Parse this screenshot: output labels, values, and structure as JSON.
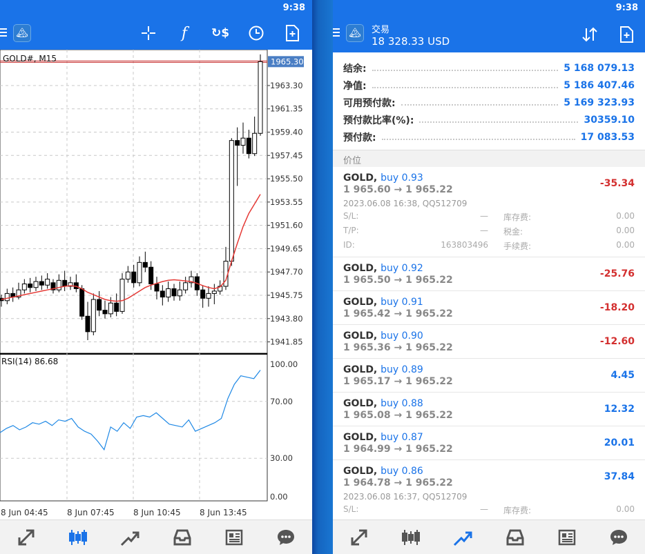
{
  "left": {
    "time": "9:38",
    "chart_title": "GOLD#, M15",
    "current_price": "1965.30",
    "price_ticks": [
      "1963.30",
      "1961.35",
      "1959.40",
      "1957.45",
      "1955.50",
      "1953.55",
      "1951.60",
      "1949.65",
      "1947.70",
      "1945.75",
      "1943.80",
      "1941.85"
    ],
    "rsi_label": "RSI(14) 86.68",
    "rsi_ticks": [
      "100.00",
      "70.00",
      "30.00",
      "0.00"
    ],
    "time_ticks": [
      "8 Jun 04:45",
      "8 Jun 07:45",
      "8 Jun 10:45",
      "8 Jun 13:45"
    ]
  },
  "right": {
    "time": "9:38",
    "title": "交易",
    "balance_header": "18 328.33 USD",
    "summary": [
      {
        "label": "结余:",
        "value": "5 168 079.13"
      },
      {
        "label": "净值:",
        "value": "5 186 407.46"
      },
      {
        "label": "可用预付款:",
        "value": "5 169 323.93"
      },
      {
        "label": "预付款比率(%):",
        "value": "30359.10"
      },
      {
        "label": "预付款:",
        "value": "17 083.53"
      }
    ],
    "section_label": "价位",
    "orders": [
      {
        "symbol": "GOLD,",
        "side": "buy 0.93",
        "prices": "1 965.60 → 1 965.22",
        "pl": "-35.34",
        "sign": "neg",
        "meta": "2023.06.08 16:38, QQ512709",
        "details": [
          [
            "S/L:",
            "—",
            "库存费:",
            "0.00"
          ],
          [
            "T/P:",
            "—",
            "税金:",
            "0.00"
          ],
          [
            "ID:",
            "163803496",
            "手续费:",
            "0.00"
          ]
        ]
      },
      {
        "symbol": "GOLD,",
        "side": "buy 0.92",
        "prices": "1 965.50 → 1 965.22",
        "pl": "-25.76",
        "sign": "neg"
      },
      {
        "symbol": "GOLD,",
        "side": "buy 0.91",
        "prices": "1 965.42 → 1 965.22",
        "pl": "-18.20",
        "sign": "neg"
      },
      {
        "symbol": "GOLD,",
        "side": "buy 0.90",
        "prices": "1 965.36 → 1 965.22",
        "pl": "-12.60",
        "sign": "neg"
      },
      {
        "symbol": "GOLD,",
        "side": "buy 0.89",
        "prices": "1 965.17 → 1 965.22",
        "pl": "4.45",
        "sign": "pos"
      },
      {
        "symbol": "GOLD,",
        "side": "buy 0.88",
        "prices": "1 965.08 → 1 965.22",
        "pl": "12.32",
        "sign": "pos"
      },
      {
        "symbol": "GOLD,",
        "side": "buy 0.87",
        "prices": "1 964.99 → 1 965.22",
        "pl": "20.01",
        "sign": "pos"
      },
      {
        "symbol": "GOLD,",
        "side": "buy 0.86",
        "prices": "1 964.78 → 1 965.22",
        "pl": "37.84",
        "sign": "pos",
        "meta": "2023.06.08 16:37, QQ512709",
        "details": [
          [
            "S/L:",
            "—",
            "库存费:",
            "0.00"
          ]
        ]
      }
    ]
  },
  "colors": {
    "accent": "#1a73e8",
    "negative": "#d32f2f",
    "candle_up": "#ffffff",
    "candle_down": "#000000",
    "ma_line": "#e53935",
    "rsi_line": "#1e88e5"
  },
  "chart_data": [
    {
      "type": "candlestick",
      "title": "GOLD#, M15",
      "ylim": [
        1940.9,
        1966.3
      ],
      "candles": [
        [
          1945.5,
          1945.3,
          1945.8,
          1944.8
        ],
        [
          1945.3,
          1945.9,
          1946.3,
          1945.0
        ],
        [
          1945.9,
          1945.6,
          1946.4,
          1945.2
        ],
        [
          1945.6,
          1946.2,
          1946.8,
          1945.4
        ],
        [
          1946.2,
          1946.7,
          1947.1,
          1945.9
        ],
        [
          1946.7,
          1946.4,
          1947.2,
          1946.0
        ],
        [
          1946.4,
          1946.9,
          1947.3,
          1946.1
        ],
        [
          1946.9,
          1946.6,
          1947.4,
          1946.2
        ],
        [
          1946.6,
          1947.1,
          1947.6,
          1946.3
        ],
        [
          1946.8,
          1946.2,
          1947.1,
          1945.9
        ],
        [
          1946.2,
          1947.0,
          1947.5,
          1946.0
        ],
        [
          1947.0,
          1946.5,
          1947.8,
          1946.1
        ],
        [
          1946.5,
          1946.8,
          1947.3,
          1946.2
        ],
        [
          1946.8,
          1946.3,
          1947.5,
          1946.0
        ],
        [
          1946.3,
          1944.0,
          1946.6,
          1943.7
        ],
        [
          1944.0,
          1942.7,
          1945.2,
          1942.0
        ],
        [
          1942.7,
          1945.4,
          1945.9,
          1942.4
        ],
        [
          1945.4,
          1944.5,
          1946.1,
          1944.0
        ],
        [
          1944.5,
          1944.2,
          1945.3,
          1943.8
        ],
        [
          1944.2,
          1945.1,
          1945.6,
          1943.9
        ],
        [
          1945.1,
          1944.4,
          1945.9,
          1944.0
        ],
        [
          1944.4,
          1947.1,
          1947.6,
          1944.2
        ],
        [
          1947.1,
          1947.7,
          1948.2,
          1946.8
        ],
        [
          1947.7,
          1946.8,
          1948.3,
          1946.4
        ],
        [
          1946.8,
          1948.5,
          1949.0,
          1946.5
        ],
        [
          1948.5,
          1948.1,
          1949.4,
          1947.7
        ],
        [
          1948.1,
          1946.7,
          1948.6,
          1946.2
        ],
        [
          1946.7,
          1946.1,
          1947.3,
          1945.4
        ],
        [
          1946.1,
          1945.6,
          1946.6,
          1944.9
        ],
        [
          1945.6,
          1946.3,
          1946.9,
          1945.2
        ],
        [
          1946.3,
          1945.7,
          1946.7,
          1945.3
        ],
        [
          1945.7,
          1946.2,
          1946.9,
          1945.3
        ],
        [
          1946.2,
          1946.8,
          1947.3,
          1945.9
        ],
        [
          1946.8,
          1947.3,
          1947.8,
          1946.4
        ],
        [
          1947.3,
          1946.2,
          1947.6,
          1945.7
        ],
        [
          1946.2,
          1945.5,
          1946.6,
          1944.7
        ],
        [
          1945.5,
          1945.9,
          1946.5,
          1944.8
        ],
        [
          1945.9,
          1946.1,
          1946.7,
          1945.0
        ],
        [
          1946.1,
          1946.5,
          1947.0,
          1945.8
        ],
        [
          1946.5,
          1948.6,
          1949.8,
          1946.2
        ],
        [
          1948.6,
          1958.7,
          1958.9,
          1948.2
        ],
        [
          1958.7,
          1958.3,
          1959.8,
          1954.9
        ],
        [
          1958.3,
          1958.9,
          1960.2,
          1957.6
        ],
        [
          1958.9,
          1957.6,
          1959.6,
          1957.2
        ],
        [
          1957.6,
          1959.3,
          1960.7,
          1957.4
        ],
        [
          1959.3,
          1965.3,
          1965.9,
          1959.1
        ]
      ],
      "moving_average": [
        1945.4,
        1945.5,
        1945.6,
        1945.7,
        1945.8,
        1945.9,
        1946.0,
        1946.1,
        1946.2,
        1946.3,
        1946.4,
        1946.5,
        1946.55,
        1946.5,
        1946.3,
        1946.0,
        1945.8,
        1945.6,
        1945.4,
        1945.3,
        1945.25,
        1945.3,
        1945.5,
        1945.8,
        1946.1,
        1946.4,
        1946.6,
        1946.75,
        1946.9,
        1947.0,
        1947.05,
        1947.0,
        1946.95,
        1946.9,
        1946.75,
        1946.55,
        1946.4,
        1946.3,
        1946.45,
        1947.0,
        1948.6,
        1950.1,
        1951.5,
        1952.6,
        1953.4,
        1954.2
      ]
    },
    {
      "type": "line",
      "title": "RSI(14) 86.68",
      "ylim": [
        0,
        100
      ],
      "values": [
        48,
        51,
        53,
        50,
        52,
        55,
        54,
        56,
        53,
        57,
        56,
        58,
        52,
        49,
        47,
        42,
        36,
        52,
        49,
        55,
        51,
        59,
        60,
        59,
        62,
        58,
        54,
        53,
        52,
        57,
        49,
        51,
        53,
        55,
        58,
        72,
        82,
        88,
        87,
        86,
        92
      ]
    }
  ]
}
